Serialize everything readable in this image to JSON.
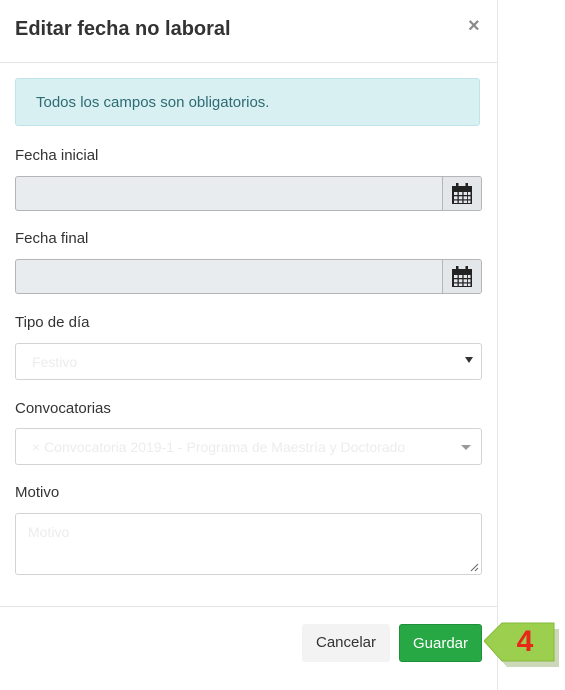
{
  "dialog": {
    "title": "Editar fecha no laboral",
    "close_label": "×"
  },
  "alert": {
    "text": "Todos los campos son obligatorios."
  },
  "fields": {
    "fecha_inicial_label": "Fecha inicial",
    "fecha_final_label": "Fecha final",
    "tipo_dia_label": "Tipo de día",
    "tipo_dia_placeholder": "Festivo",
    "convocatorias_label": "Convocatorias",
    "convocatorias_placeholder": "× Convocatoria 2019-1 - Programa de Maestría y Doctorado",
    "motivo_label": "Motivo",
    "motivo_placeholder": "Motivo"
  },
  "footer": {
    "cancel_label": "Cancelar",
    "save_label": "Guardar"
  },
  "callout": {
    "step_number": "4",
    "color": "#9ccf4e",
    "number_color": "#e8261a"
  },
  "icons": {
    "calendar": "calendar-icon",
    "close": "close-icon",
    "caret": "caret-down-icon"
  },
  "colors": {
    "alert_bg": "#d9f0f3",
    "save_button": "#28a745",
    "disabled_input": "#e9ecef"
  }
}
